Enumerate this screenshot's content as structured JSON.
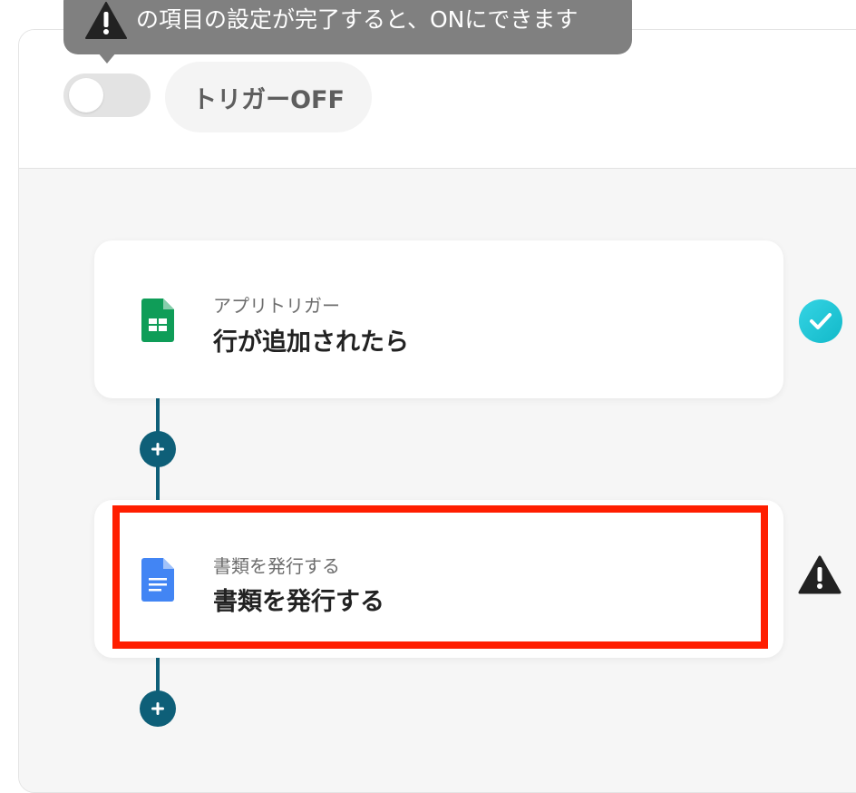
{
  "tooltip": {
    "text": "の項目の設定が完了すると、ONにできます",
    "icon": "warning-icon"
  },
  "trigger_toggle": {
    "label": "トリガーOFF",
    "state": "off"
  },
  "flow": {
    "steps": [
      {
        "app_icon": "google-sheets-icon",
        "subtitle": "アプリトリガー",
        "title": "行が追加されたら",
        "status": "complete",
        "status_icon": "check-circle-icon"
      },
      {
        "app_icon": "google-docs-icon",
        "subtitle": "書類を発行する",
        "title": "書類を発行する",
        "status": "warning",
        "status_icon": "warning-icon",
        "highlighted": true
      }
    ],
    "add_step_buttons": [
      "add-step-button",
      "add-step-button"
    ]
  },
  "colors": {
    "accent": "#0e5f78",
    "complete": "#1fc6d6",
    "warning": "#222222",
    "highlight": "#ff1e00",
    "tooltip_bg": "#808080"
  }
}
